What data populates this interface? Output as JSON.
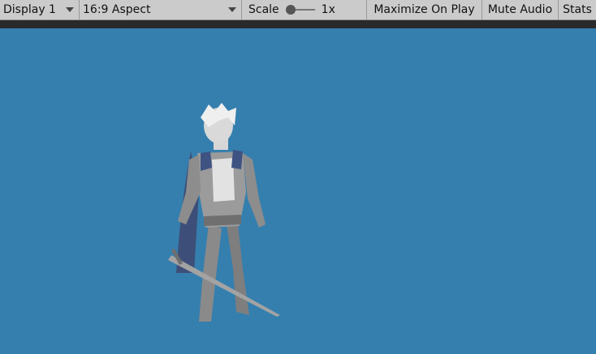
{
  "toolbar": {
    "display_label": "Display 1",
    "aspect_label": "16:9 Aspect",
    "scale_label": "Scale",
    "scale_value": "1x",
    "scale_slider_fraction": 0,
    "maximize_label": "Maximize On Play",
    "mute_label": "Mute Audio",
    "stats_label": "Stats"
  },
  "viewport": {
    "background_color": "#357fae"
  }
}
